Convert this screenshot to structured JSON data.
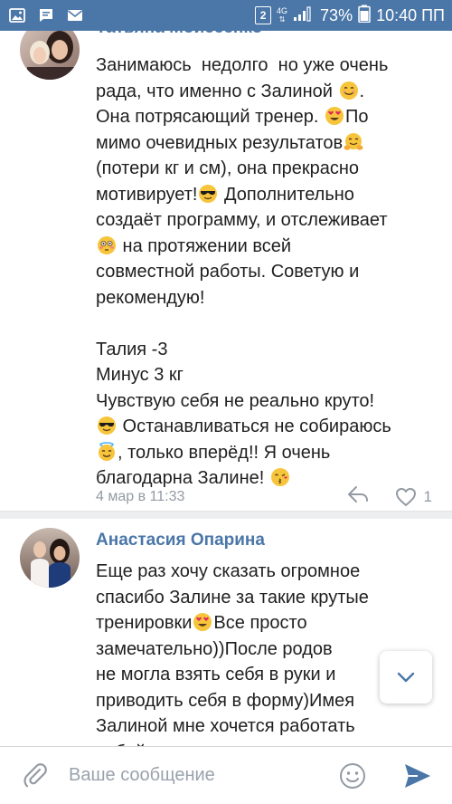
{
  "status_bar": {
    "sim_badge": "2",
    "network_type": "4G",
    "battery_percent": "73%",
    "time": "10:40 ПП",
    "colors": {
      "bar_bg": "#4a76a8"
    },
    "icons": [
      "image-notification-icon",
      "message-notification-icon",
      "mail-notification-icon",
      "sim-icon",
      "signal-icon",
      "battery-icon"
    ]
  },
  "comments": [
    {
      "author": "Татьяна Моисеенко",
      "lines": [
        [
          "Занимаюсь  недолго  но уже очень"
        ],
        [
          "рада, что именно с Залиной ",
          {
            "emoji": "smiling-face"
          },
          "."
        ],
        [
          "Она потрясающий тренер. ",
          {
            "emoji": "heart-eyes"
          },
          "По"
        ],
        [
          "мимо очевидных результатов",
          {
            "emoji": "hugging-face"
          }
        ],
        [
          "(потери кг и см), она прекрасно"
        ],
        [
          "мотивирует!",
          {
            "emoji": "sunglasses-face"
          },
          " Дополнительно"
        ],
        [
          "создаёт программу, и отслеживает"
        ],
        [
          {
            "emoji": "flushed-face"
          },
          " на протяжении всей"
        ],
        [
          "совместной работы. Советую и"
        ],
        [
          "рекомендую!"
        ],
        [
          ""
        ],
        [
          "Талия -3"
        ],
        [
          "Минус 3 кг"
        ],
        [
          "Чувствую себя не реально круто!"
        ],
        [
          {
            "emoji": "sunglasses-face"
          },
          " Останавливаться не собираюсь"
        ],
        [
          {
            "emoji": "halo-face"
          },
          ", только вперёд!! Я очень"
        ],
        [
          "благодарна Залине! ",
          {
            "emoji": "kissing-face"
          }
        ]
      ],
      "date": "4 мар в 11:33",
      "like_count": "1"
    },
    {
      "author": "Анастасия Опарина",
      "lines": [
        [
          "Еще раз хочу сказать огромное"
        ],
        [
          "спасибо Залине за такие крутые"
        ],
        [
          "тренировки",
          {
            "emoji": "heart-eyes"
          },
          "Все просто"
        ],
        [
          "замечательно))После родов"
        ],
        [
          "не могла взять себя в руки и"
        ],
        [
          "приводить себя в форму)Имея"
        ],
        [
          "Залиной мне хочется работать"
        ],
        [
          "собой, ты нереально мотивируешь"
        ]
      ]
    }
  ],
  "composer": {
    "placeholder": "Ваше сообщение"
  },
  "colors": {
    "accent": "#4a76a8",
    "meta_gray": "#939aa3",
    "separator": "#edeef0",
    "send": "#4a76a8"
  }
}
